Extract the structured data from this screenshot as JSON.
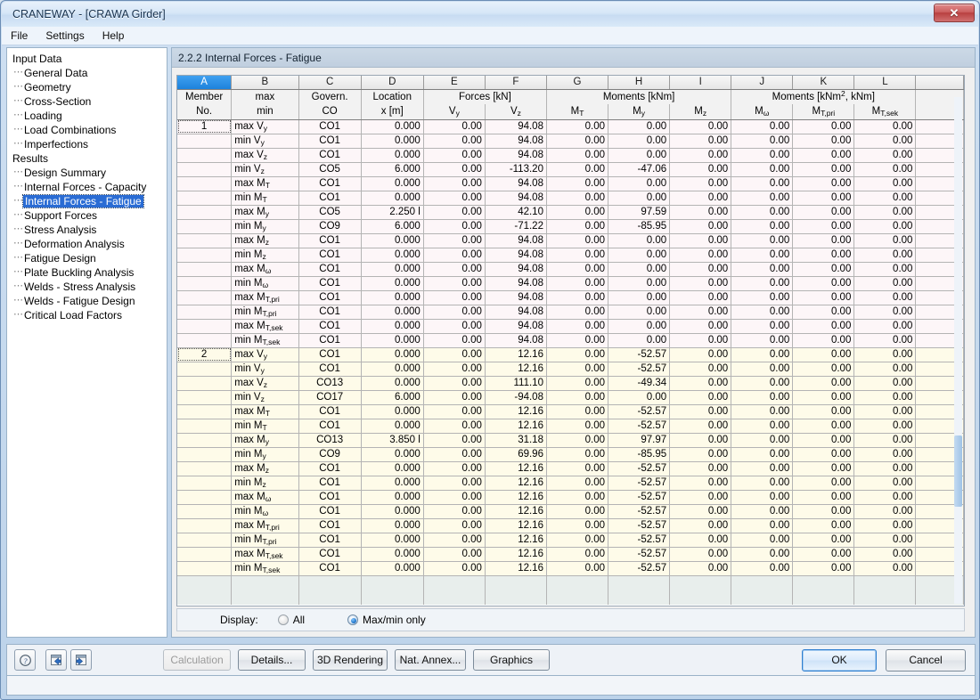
{
  "window": {
    "title": "CRANEWAY - [CRAWA Girder]",
    "close_label": "✕"
  },
  "menu": {
    "items": [
      "File",
      "Settings",
      "Help"
    ]
  },
  "sidebar": {
    "groups": [
      {
        "label": "Input Data",
        "items": [
          {
            "label": "General Data",
            "selected": false
          },
          {
            "label": "Geometry",
            "selected": false
          },
          {
            "label": "Cross-Section",
            "selected": false
          },
          {
            "label": "Loading",
            "selected": false
          },
          {
            "label": "Load Combinations",
            "selected": false
          },
          {
            "label": "Imperfections",
            "selected": false
          }
        ]
      },
      {
        "label": "Results",
        "items": [
          {
            "label": "Design Summary",
            "selected": false
          },
          {
            "label": "Internal Forces - Capacity",
            "selected": false
          },
          {
            "label": "Internal Forces - Fatigue",
            "selected": true
          },
          {
            "label": "Support Forces",
            "selected": false
          },
          {
            "label": "Stress Analysis",
            "selected": false
          },
          {
            "label": "Deformation Analysis",
            "selected": false
          },
          {
            "label": "Fatigue Design",
            "selected": false
          },
          {
            "label": "Plate Buckling Analysis",
            "selected": false
          },
          {
            "label": "Welds - Stress Analysis",
            "selected": false
          },
          {
            "label": "Welds - Fatigue Design",
            "selected": false
          },
          {
            "label": "Critical Load Factors",
            "selected": false
          }
        ]
      }
    ]
  },
  "section": {
    "title": "2.2.2 Internal Forces - Fatigue"
  },
  "table": {
    "column_letters": [
      "A",
      "B",
      "C",
      "D",
      "E",
      "F",
      "G",
      "H",
      "I",
      "J",
      "K",
      "L"
    ],
    "active_column": "A",
    "group_headers": [
      {
        "label": "Member",
        "span": 1
      },
      {
        "label": "max",
        "span": 1
      },
      {
        "label": "Govern.",
        "span": 1
      },
      {
        "label": "Location",
        "span": 1
      },
      {
        "label": "Forces [kN]",
        "span": 2
      },
      {
        "label": "Moments [kNm]",
        "span": 3
      },
      {
        "label": "Moments [kNm², kNm]",
        "span": 3
      }
    ],
    "sub_headers": [
      "No.",
      "min",
      "CO",
      "x [m]",
      "Vy",
      "Vz",
      "MT",
      "My",
      "Mz",
      "Mω",
      "MT,pri",
      "MT,sek"
    ],
    "rows": [
      {
        "member": "1",
        "case": "max Vy",
        "co": "CO1",
        "x": "0.000",
        "vy": "0.00",
        "vz": "94.08",
        "mt": "0.00",
        "my": "0.00",
        "mz": "0.00",
        "mw": "0.00",
        "mtp": "0.00",
        "mts": "0.00",
        "bold": [
          "vy"
        ]
      },
      {
        "member": "",
        "case": "min Vy",
        "co": "CO1",
        "x": "0.000",
        "vy": "0.00",
        "vz": "94.08",
        "mt": "0.00",
        "my": "0.00",
        "mz": "0.00",
        "mw": "0.00",
        "mtp": "0.00",
        "mts": "0.00",
        "bold": [
          "vy"
        ]
      },
      {
        "member": "",
        "case": "max Vz",
        "co": "CO1",
        "x": "0.000",
        "vy": "0.00",
        "vz": "94.08",
        "mt": "0.00",
        "my": "0.00",
        "mz": "0.00",
        "mw": "0.00",
        "mtp": "0.00",
        "mts": "0.00",
        "bold": [
          "vz"
        ]
      },
      {
        "member": "",
        "case": "min Vz",
        "co": "CO5",
        "x": "6.000",
        "vy": "0.00",
        "vz": "-113.20",
        "mt": "0.00",
        "my": "-47.06",
        "mz": "0.00",
        "mw": "0.00",
        "mtp": "0.00",
        "mts": "0.00",
        "bold": [
          "vz"
        ]
      },
      {
        "member": "",
        "case": "max MT",
        "co": "CO1",
        "x": "0.000",
        "vy": "0.00",
        "vz": "94.08",
        "mt": "0.00",
        "my": "0.00",
        "mz": "0.00",
        "mw": "0.00",
        "mtp": "0.00",
        "mts": "0.00",
        "bold": [
          "mt"
        ]
      },
      {
        "member": "",
        "case": "min MT",
        "co": "CO1",
        "x": "0.000",
        "vy": "0.00",
        "vz": "94.08",
        "mt": "0.00",
        "my": "0.00",
        "mz": "0.00",
        "mw": "0.00",
        "mtp": "0.00",
        "mts": "0.00",
        "bold": [
          "mt"
        ]
      },
      {
        "member": "",
        "case": "max My",
        "co": "CO5",
        "x": "2.250 l",
        "vy": "0.00",
        "vz": "42.10",
        "mt": "0.00",
        "my": "97.59",
        "mz": "0.00",
        "mw": "0.00",
        "mtp": "0.00",
        "mts": "0.00",
        "bold": [
          "my"
        ]
      },
      {
        "member": "",
        "case": "min My",
        "co": "CO9",
        "x": "6.000",
        "vy": "0.00",
        "vz": "-71.22",
        "mt": "0.00",
        "my": "-85.95",
        "mz": "0.00",
        "mw": "0.00",
        "mtp": "0.00",
        "mts": "0.00",
        "bold": [
          "my"
        ]
      },
      {
        "member": "",
        "case": "max Mz",
        "co": "CO1",
        "x": "0.000",
        "vy": "0.00",
        "vz": "94.08",
        "mt": "0.00",
        "my": "0.00",
        "mz": "0.00",
        "mw": "0.00",
        "mtp": "0.00",
        "mts": "0.00",
        "bold": [
          "mz"
        ]
      },
      {
        "member": "",
        "case": "min Mz",
        "co": "CO1",
        "x": "0.000",
        "vy": "0.00",
        "vz": "94.08",
        "mt": "0.00",
        "my": "0.00",
        "mz": "0.00",
        "mw": "0.00",
        "mtp": "0.00",
        "mts": "0.00",
        "bold": [
          "mz"
        ]
      },
      {
        "member": "",
        "case": "max Mω",
        "co": "CO1",
        "x": "0.000",
        "vy": "0.00",
        "vz": "94.08",
        "mt": "0.00",
        "my": "0.00",
        "mz": "0.00",
        "mw": "0.00",
        "mtp": "0.00",
        "mts": "0.00",
        "bold": [
          "mw"
        ]
      },
      {
        "member": "",
        "case": "min Mω",
        "co": "CO1",
        "x": "0.000",
        "vy": "0.00",
        "vz": "94.08",
        "mt": "0.00",
        "my": "0.00",
        "mz": "0.00",
        "mw": "0.00",
        "mtp": "0.00",
        "mts": "0.00",
        "bold": [
          "mw"
        ]
      },
      {
        "member": "",
        "case": "max MT,pri",
        "co": "CO1",
        "x": "0.000",
        "vy": "0.00",
        "vz": "94.08",
        "mt": "0.00",
        "my": "0.00",
        "mz": "0.00",
        "mw": "0.00",
        "mtp": "0.00",
        "mts": "0.00",
        "bold": [
          "mtp"
        ]
      },
      {
        "member": "",
        "case": "min MT,pri",
        "co": "CO1",
        "x": "0.000",
        "vy": "0.00",
        "vz": "94.08",
        "mt": "0.00",
        "my": "0.00",
        "mz": "0.00",
        "mw": "0.00",
        "mtp": "0.00",
        "mts": "0.00",
        "bold": [
          "mtp"
        ]
      },
      {
        "member": "",
        "case": "max MT,sek",
        "co": "CO1",
        "x": "0.000",
        "vy": "0.00",
        "vz": "94.08",
        "mt": "0.00",
        "my": "0.00",
        "mz": "0.00",
        "mw": "0.00",
        "mtp": "0.00",
        "mts": "0.00",
        "bold": [
          "mts"
        ]
      },
      {
        "member": "",
        "case": "min MT,sek",
        "co": "CO1",
        "x": "0.000",
        "vy": "0.00",
        "vz": "94.08",
        "mt": "0.00",
        "my": "0.00",
        "mz": "0.00",
        "mw": "0.00",
        "mtp": "0.00",
        "mts": "0.00",
        "bold": [
          "mts"
        ]
      },
      {
        "member": "2",
        "case": "max Vy",
        "co": "CO1",
        "x": "0.000",
        "vy": "0.00",
        "vz": "12.16",
        "mt": "0.00",
        "my": "-52.57",
        "mz": "0.00",
        "mw": "0.00",
        "mtp": "0.00",
        "mts": "0.00",
        "bold": [
          "vy"
        ],
        "grp": 2
      },
      {
        "member": "",
        "case": "min Vy",
        "co": "CO1",
        "x": "0.000",
        "vy": "0.00",
        "vz": "12.16",
        "mt": "0.00",
        "my": "-52.57",
        "mz": "0.00",
        "mw": "0.00",
        "mtp": "0.00",
        "mts": "0.00",
        "bold": [
          "vy"
        ],
        "grp": 2
      },
      {
        "member": "",
        "case": "max Vz",
        "co": "CO13",
        "x": "0.000",
        "vy": "0.00",
        "vz": "111.10",
        "mt": "0.00",
        "my": "-49.34",
        "mz": "0.00",
        "mw": "0.00",
        "mtp": "0.00",
        "mts": "0.00",
        "bold": [
          "vz"
        ],
        "grp": 2
      },
      {
        "member": "",
        "case": "min Vz",
        "co": "CO17",
        "x": "6.000",
        "vy": "0.00",
        "vz": "-94.08",
        "mt": "0.00",
        "my": "0.00",
        "mz": "0.00",
        "mw": "0.00",
        "mtp": "0.00",
        "mts": "0.00",
        "bold": [
          "vz"
        ],
        "grp": 2
      },
      {
        "member": "",
        "case": "max MT",
        "co": "CO1",
        "x": "0.000",
        "vy": "0.00",
        "vz": "12.16",
        "mt": "0.00",
        "my": "-52.57",
        "mz": "0.00",
        "mw": "0.00",
        "mtp": "0.00",
        "mts": "0.00",
        "bold": [
          "mt"
        ],
        "grp": 2
      },
      {
        "member": "",
        "case": "min MT",
        "co": "CO1",
        "x": "0.000",
        "vy": "0.00",
        "vz": "12.16",
        "mt": "0.00",
        "my": "-52.57",
        "mz": "0.00",
        "mw": "0.00",
        "mtp": "0.00",
        "mts": "0.00",
        "bold": [
          "mt"
        ],
        "grp": 2
      },
      {
        "member": "",
        "case": "max My",
        "co": "CO13",
        "x": "3.850 l",
        "vy": "0.00",
        "vz": "31.18",
        "mt": "0.00",
        "my": "97.97",
        "mz": "0.00",
        "mw": "0.00",
        "mtp": "0.00",
        "mts": "0.00",
        "bold": [
          "my"
        ],
        "grp": 2
      },
      {
        "member": "",
        "case": "min My",
        "co": "CO9",
        "x": "0.000",
        "vy": "0.00",
        "vz": "69.96",
        "mt": "0.00",
        "my": "-85.95",
        "mz": "0.00",
        "mw": "0.00",
        "mtp": "0.00",
        "mts": "0.00",
        "bold": [
          "my"
        ],
        "grp": 2
      },
      {
        "member": "",
        "case": "max Mz",
        "co": "CO1",
        "x": "0.000",
        "vy": "0.00",
        "vz": "12.16",
        "mt": "0.00",
        "my": "-52.57",
        "mz": "0.00",
        "mw": "0.00",
        "mtp": "0.00",
        "mts": "0.00",
        "bold": [
          "mz"
        ],
        "grp": 2
      },
      {
        "member": "",
        "case": "min Mz",
        "co": "CO1",
        "x": "0.000",
        "vy": "0.00",
        "vz": "12.16",
        "mt": "0.00",
        "my": "-52.57",
        "mz": "0.00",
        "mw": "0.00",
        "mtp": "0.00",
        "mts": "0.00",
        "bold": [
          "mz"
        ],
        "grp": 2
      },
      {
        "member": "",
        "case": "max Mω",
        "co": "CO1",
        "x": "0.000",
        "vy": "0.00",
        "vz": "12.16",
        "mt": "0.00",
        "my": "-52.57",
        "mz": "0.00",
        "mw": "0.00",
        "mtp": "0.00",
        "mts": "0.00",
        "bold": [
          "mw"
        ],
        "grp": 2
      },
      {
        "member": "",
        "case": "min Mω",
        "co": "CO1",
        "x": "0.000",
        "vy": "0.00",
        "vz": "12.16",
        "mt": "0.00",
        "my": "-52.57",
        "mz": "0.00",
        "mw": "0.00",
        "mtp": "0.00",
        "mts": "0.00",
        "bold": [
          "mw"
        ],
        "grp": 2
      },
      {
        "member": "",
        "case": "max MT,pri",
        "co": "CO1",
        "x": "0.000",
        "vy": "0.00",
        "vz": "12.16",
        "mt": "0.00",
        "my": "-52.57",
        "mz": "0.00",
        "mw": "0.00",
        "mtp": "0.00",
        "mts": "0.00",
        "bold": [
          "mtp"
        ],
        "grp": 2
      },
      {
        "member": "",
        "case": "min MT,pri",
        "co": "CO1",
        "x": "0.000",
        "vy": "0.00",
        "vz": "12.16",
        "mt": "0.00",
        "my": "-52.57",
        "mz": "0.00",
        "mw": "0.00",
        "mtp": "0.00",
        "mts": "0.00",
        "bold": [
          "mtp"
        ],
        "grp": 2
      },
      {
        "member": "",
        "case": "max MT,sek",
        "co": "CO1",
        "x": "0.000",
        "vy": "0.00",
        "vz": "12.16",
        "mt": "0.00",
        "my": "-52.57",
        "mz": "0.00",
        "mw": "0.00",
        "mtp": "0.00",
        "mts": "0.00",
        "bold": [
          "mts"
        ],
        "grp": 2
      },
      {
        "member": "",
        "case": "min MT,sek",
        "co": "CO1",
        "x": "0.000",
        "vy": "0.00",
        "vz": "12.16",
        "mt": "0.00",
        "my": "-52.57",
        "mz": "0.00",
        "mw": "0.00",
        "mtp": "0.00",
        "mts": "0.00",
        "bold": [
          "mts"
        ],
        "grp": 2
      }
    ]
  },
  "display": {
    "label": "Display:",
    "options": [
      {
        "label": "All",
        "selected": false
      },
      {
        "label": "Max/min only",
        "selected": true
      }
    ]
  },
  "footer": {
    "icons": [
      "help-icon",
      "previous-icon",
      "next-icon"
    ],
    "buttons": [
      {
        "label": "Calculation",
        "disabled": true
      },
      {
        "label": "Details...",
        "disabled": false
      },
      {
        "label": "3D Rendering",
        "disabled": false
      },
      {
        "label": "Nat. Annex...",
        "disabled": false
      },
      {
        "label": "Graphics",
        "disabled": false
      }
    ],
    "ok_label": "OK",
    "cancel_label": "Cancel"
  },
  "colors": {
    "accent": "#2a6cd4",
    "member1_row": "#fdf6f8",
    "member2_row": "#fefbe9",
    "header": "#f2f2f2"
  }
}
